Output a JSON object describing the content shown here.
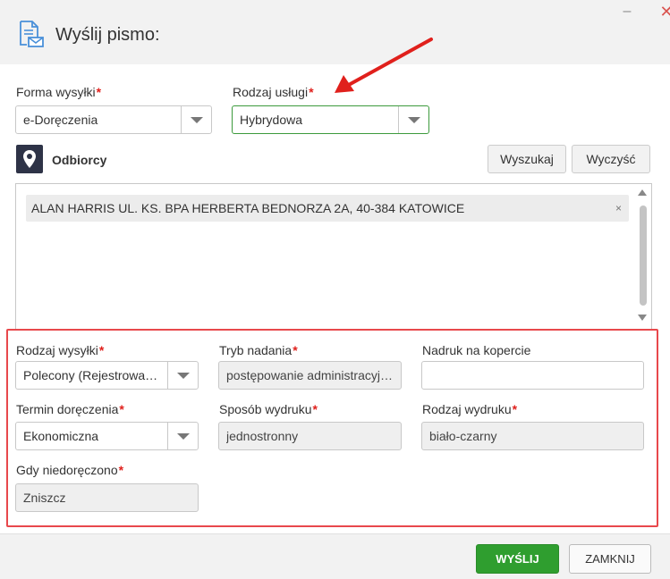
{
  "dialog": {
    "title": "Wyślij pismo:",
    "minimize_label": "–",
    "close_label": "✕"
  },
  "forma_wysylki": {
    "label": "Forma wysyłki",
    "value": "e-Doręczenia"
  },
  "rodzaj_uslugi": {
    "label": "Rodzaj usługi",
    "value": "Hybrydowa"
  },
  "odbiorcy": {
    "label": "Odbiorcy",
    "search_button": "Wyszukaj",
    "clear_button": "Wyczyść",
    "items": [
      {
        "text": "ALAN HARRIS UL. KS. BPA HERBERTA BEDNORZA 2A, 40-384 KATOWICE",
        "remove": "×"
      }
    ]
  },
  "details": {
    "rodzaj_wysylki": {
      "label": "Rodzaj wysyłki",
      "value": "Polecony (Rejestrowan…"
    },
    "tryb_nadania": {
      "label": "Tryb nadania",
      "value": "postępowanie administracyj…"
    },
    "nadruk": {
      "label": "Nadruk na kopercie",
      "value": ""
    },
    "termin_doreczenia": {
      "label": "Termin doręczenia",
      "value": "Ekonomiczna"
    },
    "sposob_wydruku": {
      "label": "Sposób wydruku",
      "value": "jednostronny"
    },
    "rodzaj_wydruku": {
      "label": "Rodzaj wydruku",
      "value": "biało-czarny"
    },
    "gdy_niedoreczono": {
      "label": "Gdy niedoręczono",
      "value": "Zniszcz"
    }
  },
  "required_mark": "*",
  "footer": {
    "send_label": "WYŚLIJ",
    "close_label": "ZAMKNIJ"
  },
  "colors": {
    "accent_green": "#2f9e2f",
    "highlight_red": "#e8484c",
    "arrow_red": "#e0201c",
    "required_red": "#e0201c"
  }
}
